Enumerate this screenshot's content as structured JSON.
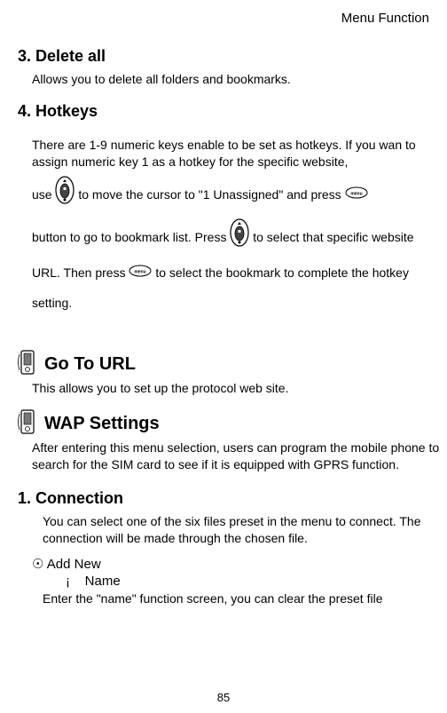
{
  "header": "Menu Function",
  "s3": {
    "title": "3. Delete all",
    "body": "Allows you to delete all folders and bookmarks."
  },
  "s4": {
    "title": "4. Hotkeys",
    "p1": "There are 1-9 numeric keys enable to be set as hotkeys. If you wan to assign numeric key 1 as a hotkey for the specific website,",
    "p2a": "use ",
    "p2b": " to move the cursor to \"1 Unassigned\" and press ",
    "p3a": "button to go to bookmark list. Press ",
    "p3b": " to select that specific website URL.    Then press ",
    "p3c": " to select the bookmark to complete the hotkey setting."
  },
  "goto": {
    "title": " Go To URL",
    "body": "This allows you to set up the protocol web site."
  },
  "wap": {
    "title": " WAP Settings",
    "body": "After entering this menu selection, users can program the mobile phone to search for the SIM card to see if it is equipped with GPRS function."
  },
  "conn": {
    "title": "1. Connection",
    "body": "You can select one of the six files preset in the menu to connect. The connection will be made through the chosen file.",
    "add_new": "Add New",
    "name_label": "Name",
    "name_prefix": "¡",
    "name_body": "Enter the \"name\" function screen, you can clear the preset file"
  },
  "page_number": "85",
  "bullet": "☉"
}
